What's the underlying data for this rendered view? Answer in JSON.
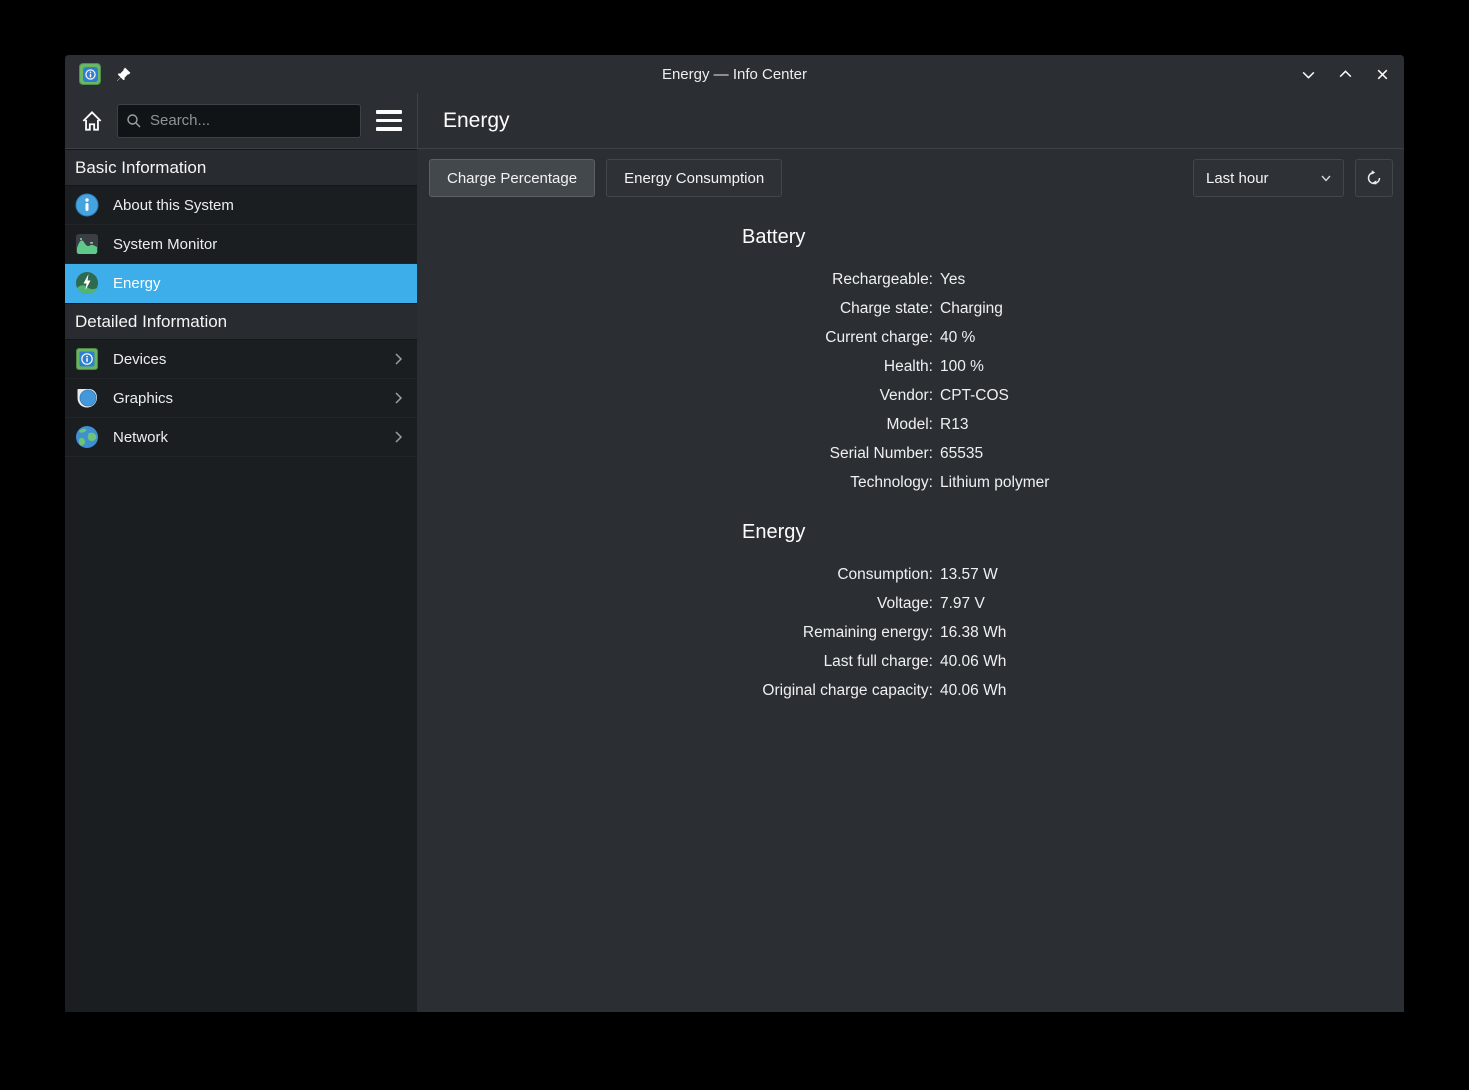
{
  "window": {
    "title": "Energy — Info Center"
  },
  "colors": {
    "accent_selection": "#3daee9",
    "window_bg": "#2b2f33",
    "sidebar_bg": "#1b1e21"
  },
  "header": {
    "page_title": "Energy"
  },
  "sidebar": {
    "search_placeholder": "Search...",
    "section_basic": "Basic Information",
    "section_detailed": "Detailed Information",
    "items_basic": [
      {
        "label": "About this System",
        "icon": "info-icon",
        "selected": false
      },
      {
        "label": "System Monitor",
        "icon": "system-monitor-icon",
        "selected": false
      },
      {
        "label": "Energy",
        "icon": "energy-icon",
        "selected": true
      }
    ],
    "items_detailed": [
      {
        "label": "Devices",
        "icon": "devices-icon"
      },
      {
        "label": "Graphics",
        "icon": "graphics-icon"
      },
      {
        "label": "Network",
        "icon": "network-icon"
      }
    ]
  },
  "toolbar": {
    "charge_percentage_label": "Charge Percentage",
    "energy_consumption_label": "Energy Consumption",
    "timespan_value": "Last hour"
  },
  "battery": {
    "heading": "Battery",
    "rows": [
      {
        "label": "Rechargeable:",
        "value": "Yes"
      },
      {
        "label": "Charge state:",
        "value": "Charging"
      },
      {
        "label": "Current charge:",
        "value": "40 %"
      },
      {
        "label": "Health:",
        "value": "100 %"
      },
      {
        "label": "Vendor:",
        "value": "CPT-COS"
      },
      {
        "label": "Model:",
        "value": "R13"
      },
      {
        "label": "Serial Number:",
        "value": "65535"
      },
      {
        "label": "Technology:",
        "value": "Lithium polymer"
      }
    ]
  },
  "energy": {
    "heading": "Energy",
    "rows": [
      {
        "label": "Consumption:",
        "value": "13.57 W"
      },
      {
        "label": "Voltage:",
        "value": "7.97 V"
      },
      {
        "label": "Remaining energy:",
        "value": "16.38 Wh"
      },
      {
        "label": "Last full charge:",
        "value": "40.06 Wh"
      },
      {
        "label": "Original charge capacity:",
        "value": "40.06 Wh"
      }
    ]
  }
}
